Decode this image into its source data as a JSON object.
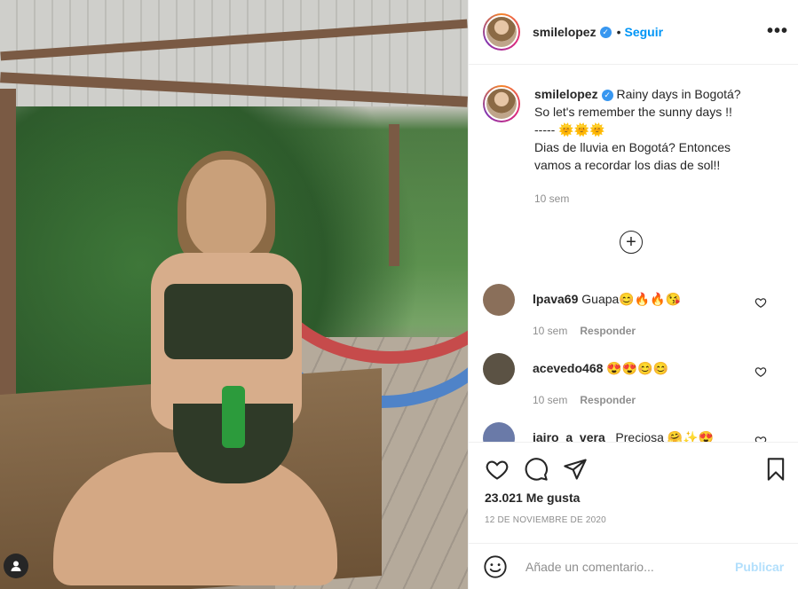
{
  "post": {
    "username": "smilelopez",
    "follow_label": "Seguir",
    "separator": "•",
    "more_label": "•••"
  },
  "caption": {
    "username": "smilelopez",
    "lines": [
      "Rainy days in Bogotá?",
      "So let's remember the sunny days !!",
      "----- 🌞🌞🌞",
      "Dias de lluvia en Bogotá? Entonces",
      "vamos a recordar los dias de sol!!"
    ],
    "time": "10 sem"
  },
  "load_more_label": "+",
  "comments": [
    {
      "username": "lpava69",
      "text": "Guapa😊🔥🔥😘",
      "time": "10 sem",
      "reply": "Responder",
      "avatar_color": "#8a6f5a"
    },
    {
      "username": "acevedo468",
      "text": "😍😍😊😊",
      "time": "10 sem",
      "reply": "Responder",
      "avatar_color": "#5b5244"
    },
    {
      "username": "jairo_a_vera_",
      "text": "Preciosa 🤗✨😍",
      "time": "",
      "reply": "",
      "avatar_color": "#6a7aa8"
    }
  ],
  "actions": {
    "like_icon": "heart-icon",
    "comment_icon": "comment-icon",
    "share_icon": "paper-plane-icon",
    "save_icon": "bookmark-icon"
  },
  "likes": "23.021 Me gusta",
  "date": "12 DE NOVIEMBRE DE 2020",
  "comment_box": {
    "placeholder": "Añade un comentario...",
    "publish_label": "Publicar"
  },
  "colors": {
    "link_blue": "#0095f6",
    "publish_disabled": "#b2dffc",
    "muted": "#8e8e8e"
  }
}
